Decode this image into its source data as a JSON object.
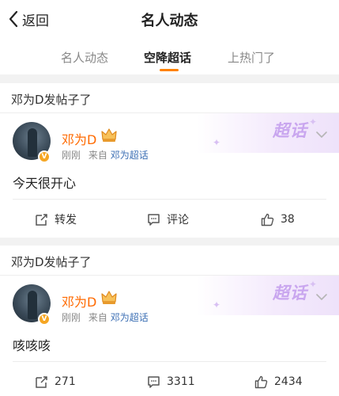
{
  "header": {
    "back_label": "返回",
    "title": "名人动态"
  },
  "tabs": [
    {
      "label": "名人动态",
      "active": false
    },
    {
      "label": "空降超话",
      "active": true
    },
    {
      "label": "上热门了",
      "active": false
    }
  ],
  "accent_color": "#ff8200",
  "posts": [
    {
      "header_text": "邓为D发帖子了",
      "supertopic_badge": "超话",
      "username": "邓为D",
      "time": "刚刚",
      "source_prefix": "来自",
      "source_link": "邓为超话",
      "content": "今天很开心",
      "actions": {
        "repost": "转发",
        "comment": "评论",
        "like": "38"
      }
    },
    {
      "header_text": "邓为D发帖子了",
      "supertopic_badge": "超话",
      "username": "邓为D",
      "time": "刚刚",
      "source_prefix": "来自",
      "source_link": "邓为超话",
      "content": "咳咳咳",
      "actions": {
        "repost": "271",
        "comment": "3311",
        "like": "2434"
      }
    }
  ]
}
